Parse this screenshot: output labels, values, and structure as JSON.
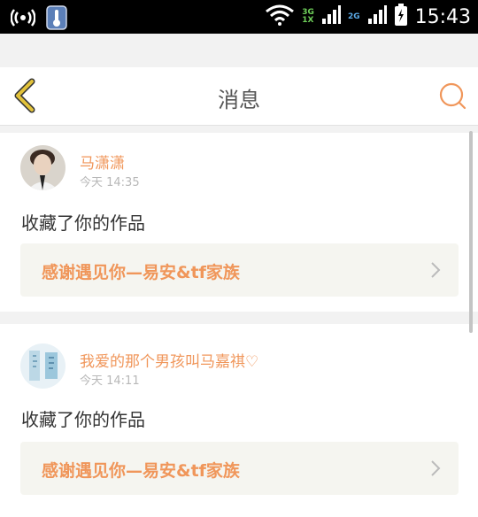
{
  "status_bar": {
    "time": "15:43",
    "network_top": "3G",
    "network_bottom": "1X",
    "network2": "2G",
    "icons": [
      "hotspot-icon",
      "thermometer-icon",
      "wifi-icon",
      "signal-icon",
      "battery-icon"
    ]
  },
  "header": {
    "title": "消息"
  },
  "messages": [
    {
      "user": "马潇潇",
      "time": "今天 14:35",
      "action": "收藏了你的作品",
      "work_title": "感谢遇见你—易安&tf家族"
    },
    {
      "user": "我爱的那个男孩叫马嘉祺♡",
      "time": "今天 14:11",
      "action": "收藏了你的作品",
      "work_title": "感谢遇见你—易安&tf家族"
    }
  ],
  "colors": {
    "accent": "#f0965a",
    "back_arrow": "#e2c23a",
    "status_bar": "#000000"
  }
}
